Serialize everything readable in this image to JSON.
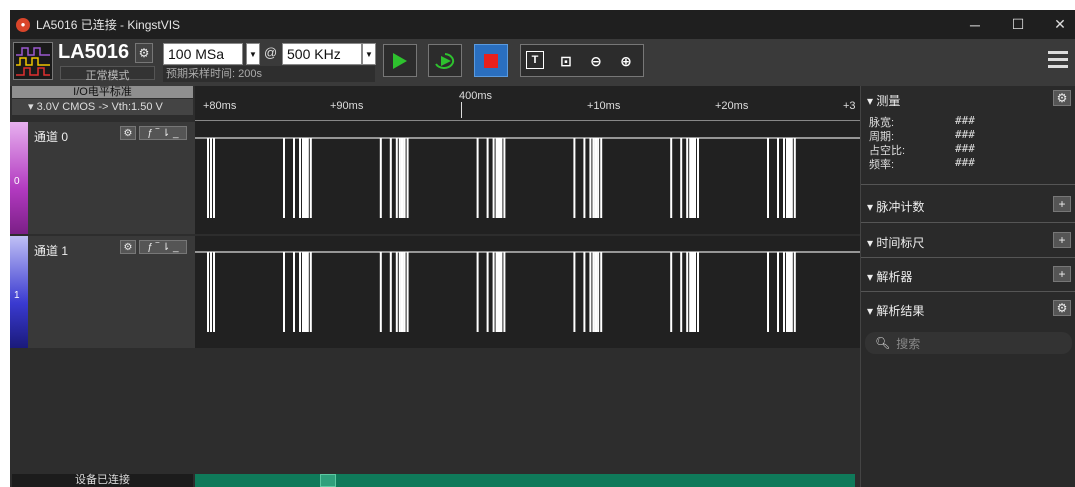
{
  "window": {
    "title": "LA5016 已连接 - KingstVIS",
    "minimize": "─",
    "maximize": "☐",
    "close": "✕"
  },
  "device": {
    "name": "LA5016",
    "mode": "正常模式",
    "sample_depth": "100 MSa",
    "at": "@",
    "sample_rate": "500 KHz",
    "pretrigger_time": "预期采样时间: 200s"
  },
  "io": {
    "header": "I/O电平标准",
    "value": "▾ 3.0V CMOS -> Vth:1.50 V"
  },
  "channels": [
    {
      "name": "通道 0",
      "num": "0"
    },
    {
      "name": "通道 1",
      "num": "1"
    }
  ],
  "ruler": {
    "center": "400ms",
    "ticks": [
      "+80ms",
      "+90ms",
      "+10ms",
      "+20ms",
      "+3"
    ]
  },
  "status": {
    "left": "设备已连接"
  },
  "right_panel": {
    "measure": {
      "title": "▾ 测量",
      "items": [
        {
          "label": "脉宽:",
          "value": "###"
        },
        {
          "label": "周期:",
          "value": "###"
        },
        {
          "label": "占空比:",
          "value": "###"
        },
        {
          "label": "频率:",
          "value": "###"
        }
      ]
    },
    "pulse_count": "▾ 脉冲计数",
    "time_ruler": "▾ 时间标尺",
    "analyzer": "▾ 解析器",
    "results": "▾ 解析结果",
    "search_placeholder": "搜索"
  },
  "colors": {
    "ch0": "#b23ac0",
    "ch1": "#3a3ad0",
    "play": "#2ec22e",
    "stop": "#e8201c",
    "status_bar": "#0f7a5a"
  }
}
